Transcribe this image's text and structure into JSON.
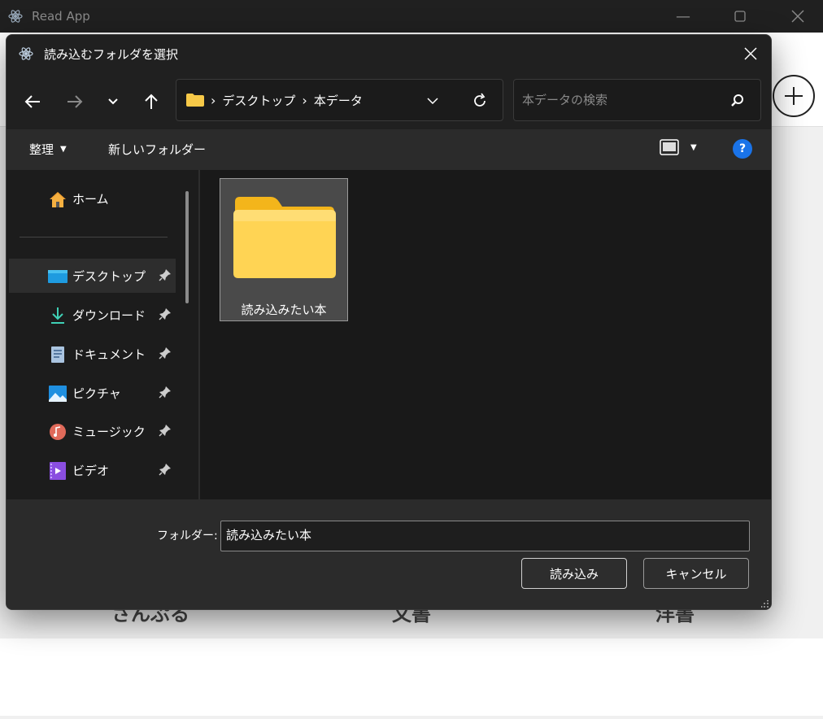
{
  "app": {
    "title": "Read App",
    "categories": [
      "さんぷる",
      "文書",
      "洋書"
    ]
  },
  "dialog": {
    "title": "読み込むフォルダを選択",
    "breadcrumbs": [
      "デスクトップ",
      "本データ"
    ],
    "search_placeholder": "本データの検索",
    "toolbar": {
      "organize_label": "整理",
      "new_folder_label": "新しいフォルダー"
    },
    "nav": {
      "home": "ホーム",
      "items": [
        {
          "label": "デスクトップ",
          "icon": "desktop-icon",
          "selected": true
        },
        {
          "label": "ダウンロード",
          "icon": "download-icon"
        },
        {
          "label": "ドキュメント",
          "icon": "documents-icon"
        },
        {
          "label": "ピクチャ",
          "icon": "pictures-icon"
        },
        {
          "label": "ミュージック",
          "icon": "music-icon"
        },
        {
          "label": "ビデオ",
          "icon": "video-icon"
        }
      ]
    },
    "content": {
      "folders": [
        {
          "name": "読み込みたい本"
        }
      ]
    },
    "footer": {
      "folder_label": "フォルダー:",
      "folder_value": "読み込みたい本",
      "ok_label": "読み込み",
      "cancel_label": "キャンセル"
    }
  },
  "colors": {
    "dialog_bg": "#202020",
    "accent": "#1a73e8",
    "folder_yellow": "#f7c948"
  }
}
